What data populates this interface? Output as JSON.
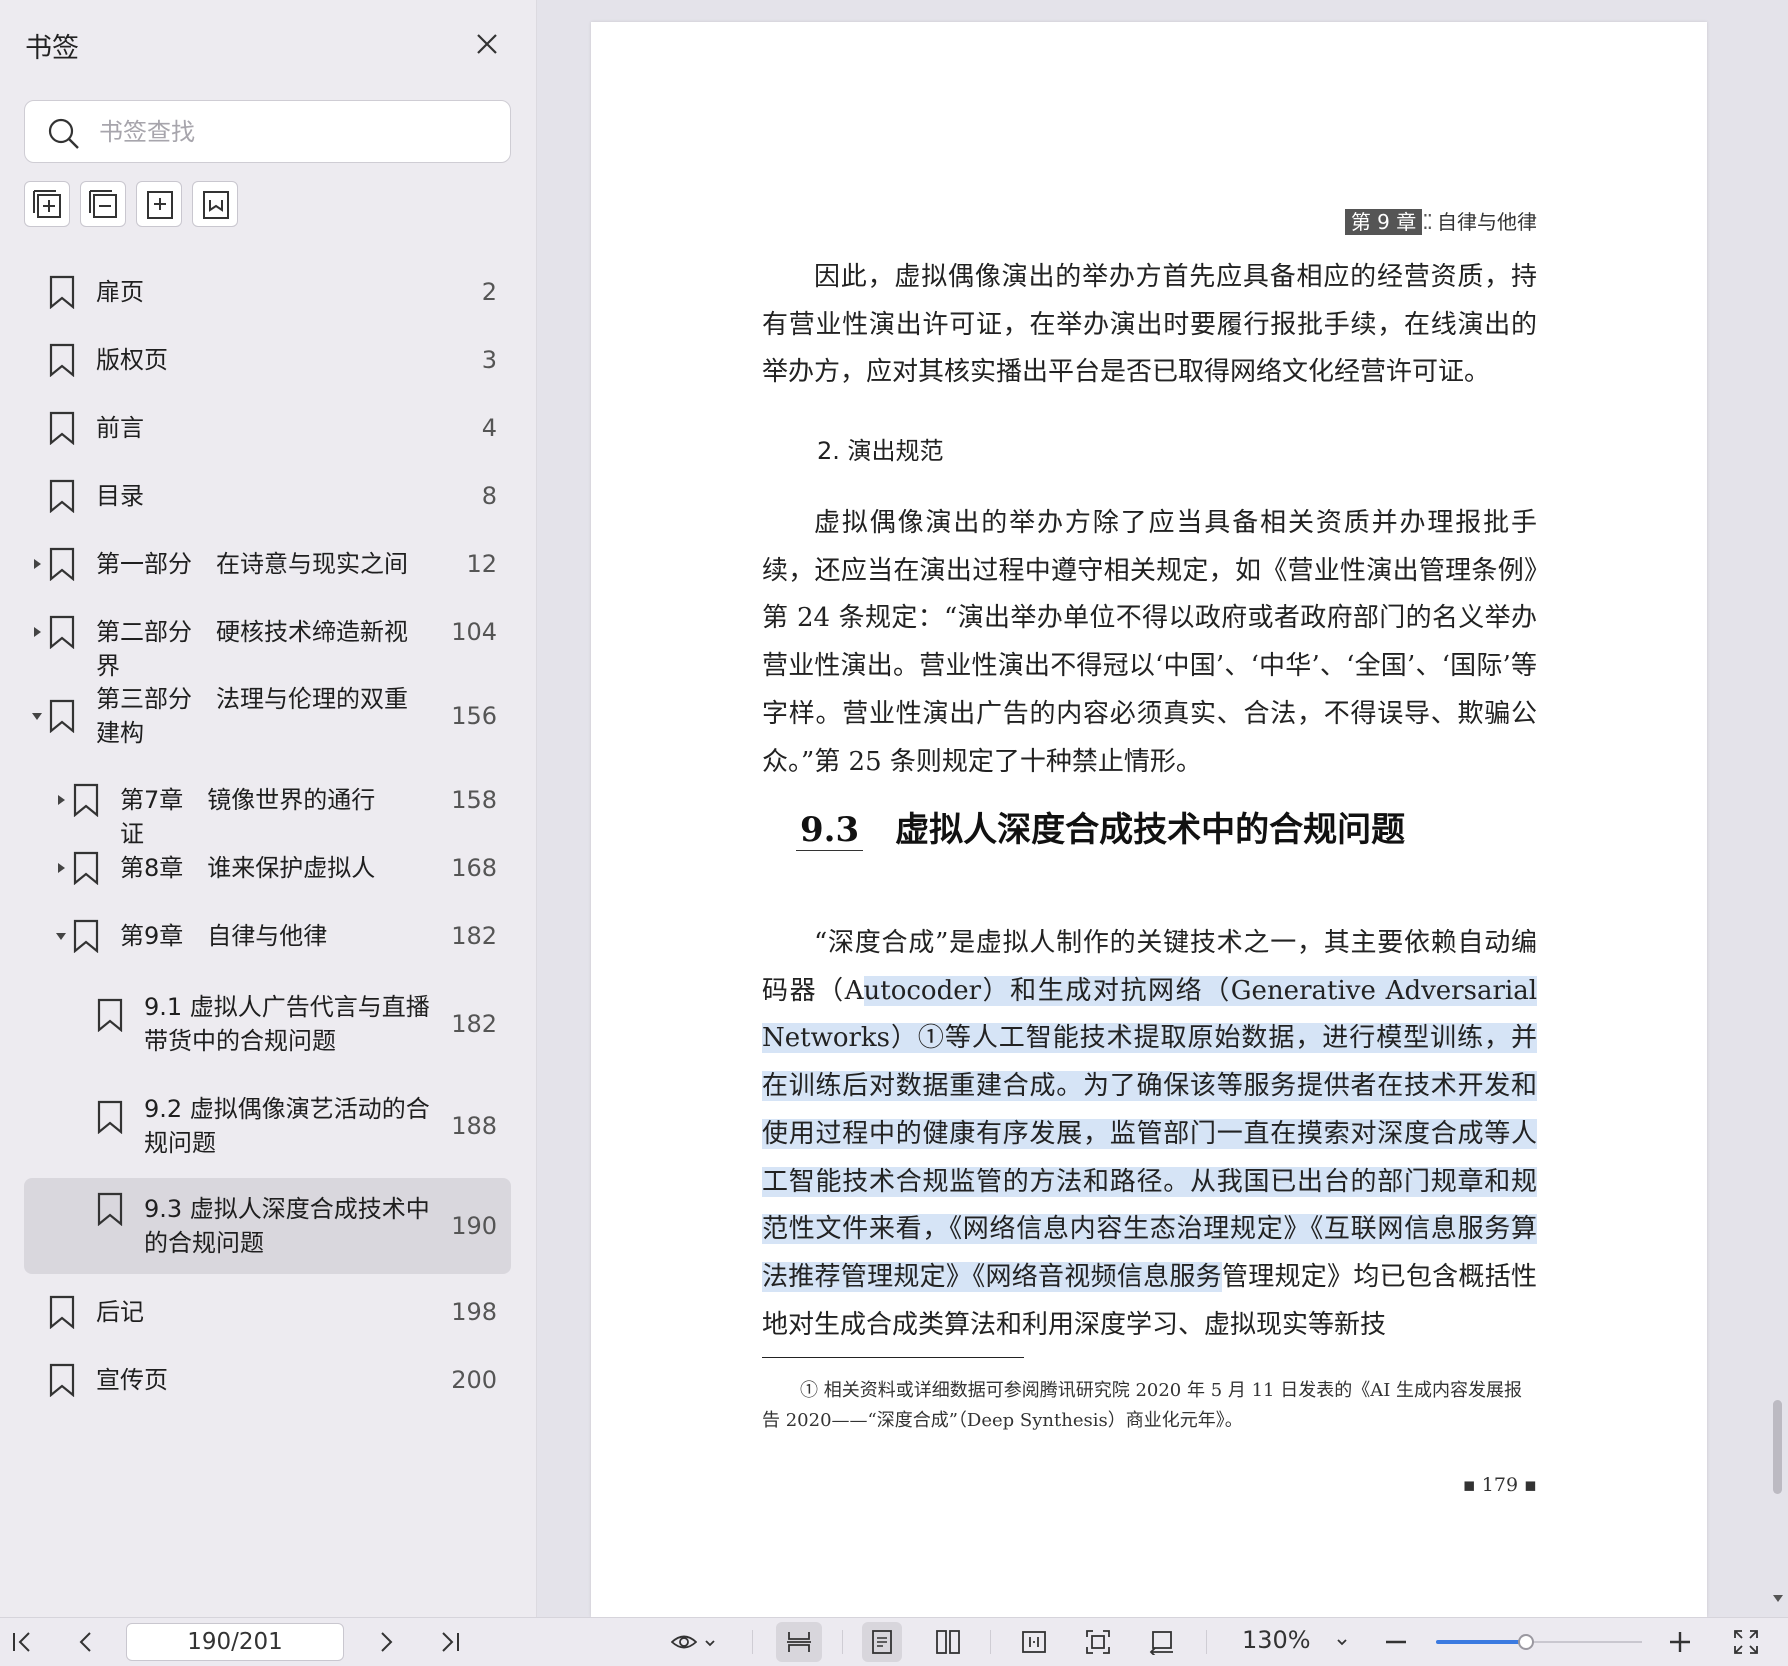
{
  "sidebar": {
    "title": "书签",
    "search_placeholder": "书签查找",
    "items": [
      {
        "label": "扉页",
        "page": "2",
        "level": 0,
        "expand": "none"
      },
      {
        "label": "版权页",
        "page": "3",
        "level": 0,
        "expand": "none"
      },
      {
        "label": "前言",
        "page": "4",
        "level": 0,
        "expand": "none"
      },
      {
        "label": "目录",
        "page": "8",
        "level": 0,
        "expand": "none"
      },
      {
        "label": "第一部分　在诗意与现实之间",
        "page": "12",
        "level": 0,
        "expand": "collapsed"
      },
      {
        "label": "第二部分　硬核技术缔造新视界",
        "page": "104",
        "level": 0,
        "expand": "collapsed"
      },
      {
        "label": "第三部分　法理与伦理的双重建构",
        "page": "156",
        "level": 0,
        "expand": "expanded"
      },
      {
        "label": "第7章　镜像世界的通行证",
        "page": "158",
        "level": 1,
        "expand": "collapsed"
      },
      {
        "label": "第8章　谁来保护虚拟人",
        "page": "168",
        "level": 1,
        "expand": "collapsed"
      },
      {
        "label": "第9章　自律与他律",
        "page": "182",
        "level": 1,
        "expand": "expanded"
      },
      {
        "label": "9.1  虚拟人广告代言与直播带货中的合规问题",
        "page": "182",
        "level": 2,
        "expand": "none"
      },
      {
        "label": "9.2  虚拟偶像演艺活动的合规问题",
        "page": "188",
        "level": 2,
        "expand": "none"
      },
      {
        "label": "9.3  虚拟人深度合成技术中的合规问题",
        "page": "190",
        "level": 2,
        "expand": "none",
        "active": true
      },
      {
        "label": "后记",
        "page": "198",
        "level": 0,
        "expand": "none"
      },
      {
        "label": "宣传页",
        "page": "200",
        "level": 0,
        "expand": "none"
      }
    ]
  },
  "page": {
    "running_head_chapter": "第 9 章",
    "running_head_dots": "⁚⁚",
    "running_head_title": "自律与他律",
    "para1": "因此，虚拟偶像演出的举办方首先应具备相应的经营资质，持有营业性演出许可证，在举办演出时要履行报批手续，在线演出的举办方，应对其核实播出平台是否已取得网络文化经营许可证。",
    "sub_heading": "2. 演出规范",
    "para2": "虚拟偶像演出的举办方除了应当具备相关资质并办理报批手续，还应当在演出过程中遵守相关规定，如《营业性演出管理条例》第 24 条规定：“演出举办单位不得以政府或者政府部门的名义举办营业性演出。营业性演出不得冠以‘中国’、‘中华’、‘全国’、‘国际’等字样。营业性演出广告的内容必须真实、合法，不得误导、欺骗公众。”第 25 条则规定了十种禁止情形。",
    "section_number": "9.3",
    "section_title": "虚拟人深度合成技术中的合规问题",
    "para3_a": "“深度合成”是虚拟人制作的关键技术之一，其主要依赖自动编码器（A",
    "para3_highlight": "utocoder）和生成对抗网络（Generative Adversarial Networks）①等人工智能技术提取原始数据，进行模型训练，并在训练后对数据重建合成。为了确保该等服务提供者在技术开发和使用过程中的健康有序发展，监管部门一直在摸索对深度合成等人工智能技术合规监管的方法和路径。从我国已出台的部门规章和规范性文件来看，《网络信息内容生态治理规定》《互联网信息服务算法推荐管理规定》《网络音视频信息服务",
    "para3_b": "管理规定》均已包含概括性地对生成合成类算法和利用深度学习、虚拟现实等新技",
    "footnote": "①  相关资料或详细数据可参阅腾讯研究院 2020 年 5 月 11 日发表的《AI 生成内容发展报告 2020——“深度合成”（Deep Synthesis）商业化元年》。",
    "page_number": "▪ 179 ▪"
  },
  "toolbar": {
    "page_indicator": "190/201",
    "zoom": "130%",
    "zoom_level": 0.44
  },
  "colors": {
    "highlight": "#d6e4f6",
    "accent": "#3b7ae0"
  }
}
